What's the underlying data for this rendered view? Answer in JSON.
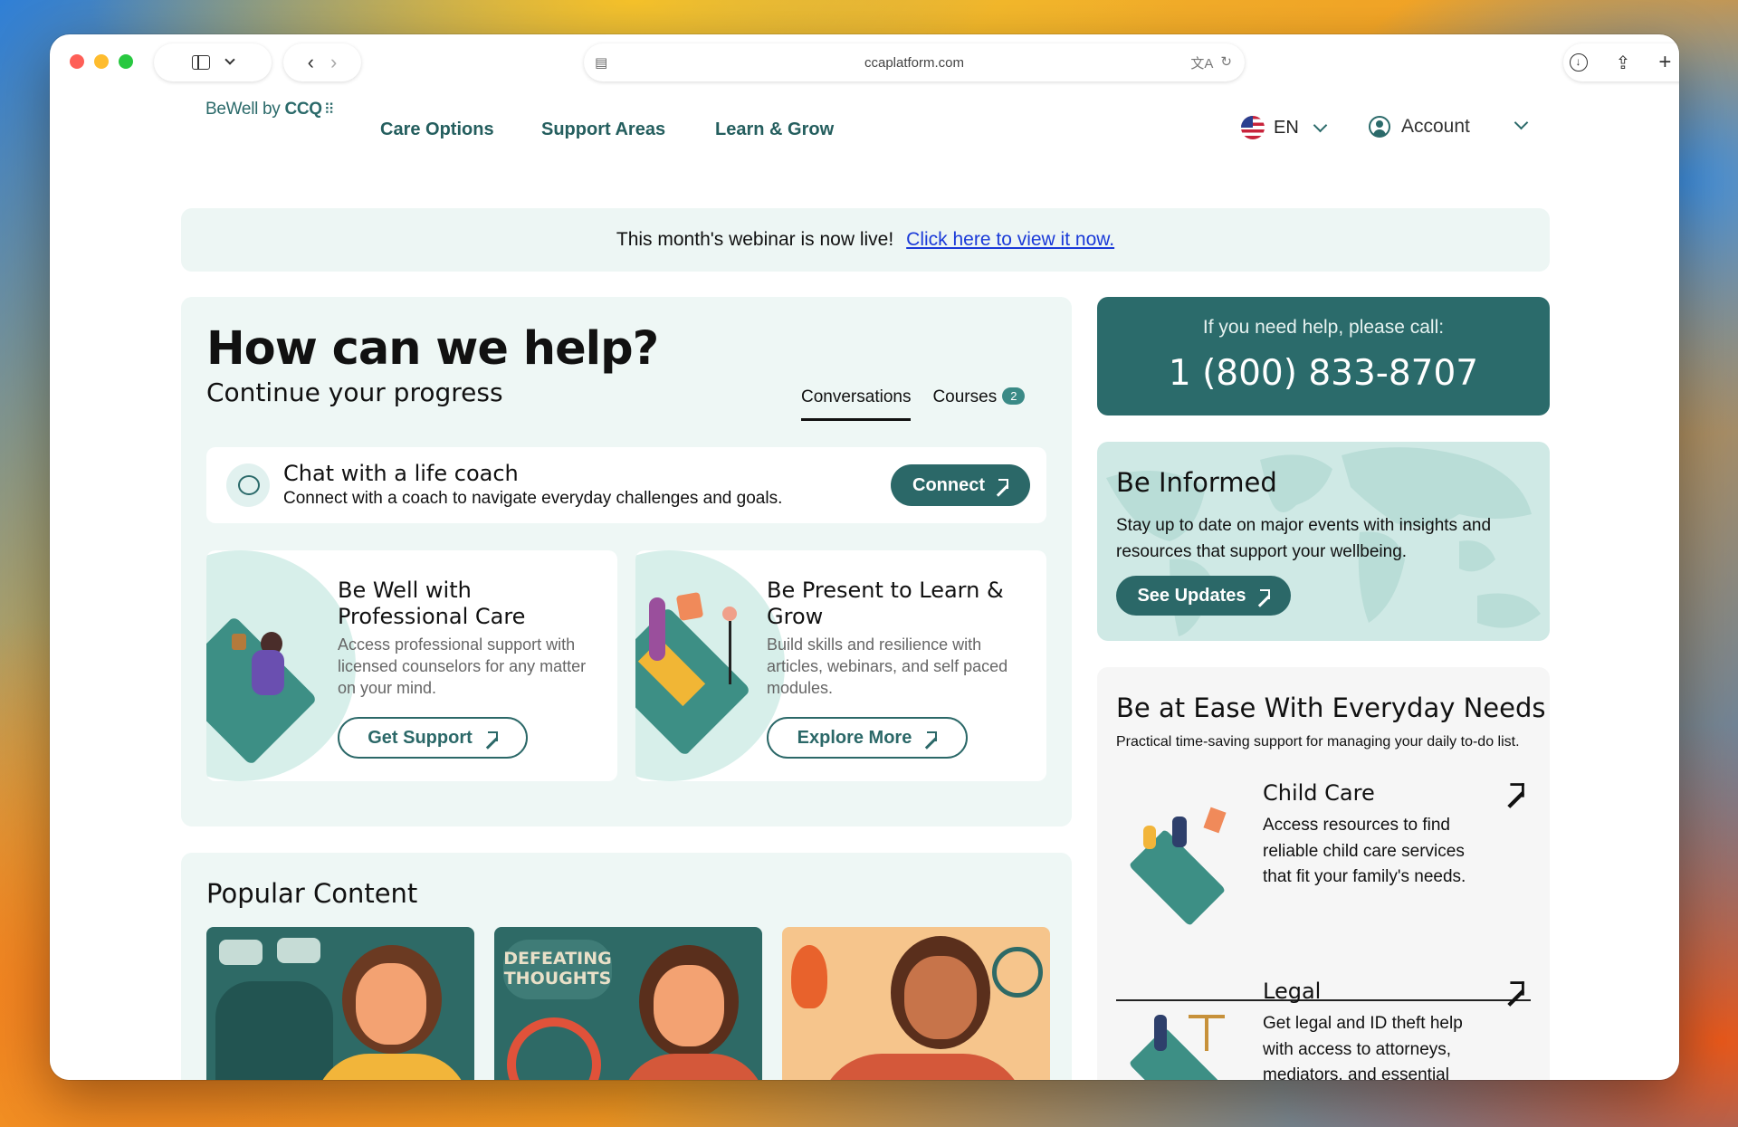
{
  "browser": {
    "url": "ccaplatform.com"
  },
  "header": {
    "logo_text": "BeWell by ",
    "logo_brand": "CCQ",
    "nav": [
      "Care Options",
      "Support Areas",
      "Learn & Grow"
    ],
    "language": "EN",
    "account_label": "Account"
  },
  "banner": {
    "text": "This month's webinar is now live!",
    "link_text": "Click here to view it now."
  },
  "help": {
    "title": "How can we help?",
    "subtitle": "Continue your progress",
    "tabs": [
      {
        "label": "Conversations",
        "active": true
      },
      {
        "label": "Courses",
        "badge": "2"
      }
    ],
    "coach": {
      "title": "Chat with a life coach",
      "description": "Connect with a coach to navigate everyday challenges and goals.",
      "button": "Connect"
    },
    "cards": [
      {
        "title": "Be Well with Professional Care",
        "description": "Access professional support with licensed counselors for any matter on your mind.",
        "button": "Get Support"
      },
      {
        "title": "Be Present to Learn & Grow",
        "description": "Build skills and resilience with articles, webinars, and self paced modules.",
        "button": "Explore More"
      }
    ]
  },
  "popular": {
    "title": "Popular Content",
    "thumbnails": [
      {
        "illustration": "woman-hand-on-chest"
      },
      {
        "illustration": "defeating-thoughts",
        "caption": "DEFEATING THOUGHTS"
      },
      {
        "illustration": "burnout-clock"
      }
    ]
  },
  "call": {
    "label": "If you need help, please call:",
    "number": "1 (800) 833-8707"
  },
  "informed": {
    "title": "Be Informed",
    "description": "Stay up to date on major events with insights and resources that support your wellbeing.",
    "button": "See Updates"
  },
  "ease": {
    "title": "Be at Ease With Everyday Needs",
    "subtitle": "Practical time-saving support for managing your daily to-do list.",
    "items": [
      {
        "name": "Child Care",
        "description": "Access resources to find reliable child care services that fit your family's needs."
      },
      {
        "name": "Legal",
        "description": "Get legal and ID theft help with access to attorneys, mediators, and essential documents—stress-free."
      }
    ]
  },
  "colors": {
    "brand": "#2b6868",
    "card_bg": "#eef7f5",
    "link": "#1a3ad8"
  }
}
